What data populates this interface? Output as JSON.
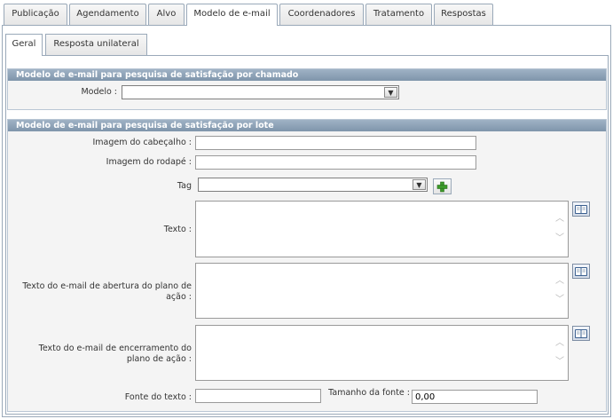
{
  "tabs": [
    {
      "label": "Publicação",
      "active": false
    },
    {
      "label": "Agendamento",
      "active": false
    },
    {
      "label": "Alvo",
      "active": false
    },
    {
      "label": "Modelo de e-mail",
      "active": true
    },
    {
      "label": "Coordenadores",
      "active": false
    },
    {
      "label": "Tratamento",
      "active": false
    },
    {
      "label": "Respostas",
      "active": false
    }
  ],
  "subtabs": [
    {
      "label": "Geral",
      "active": true
    },
    {
      "label": "Resposta unilateral",
      "active": false
    }
  ],
  "section_chamado": {
    "title": "Modelo de e-mail para pesquisa de satisfação por chamado",
    "modelo_label": "Modelo :",
    "modelo_value": ""
  },
  "section_lote": {
    "title": "Modelo de e-mail para pesquisa de satisfação por lote",
    "imagem_cabecalho_label": "Imagem do cabeçalho :",
    "imagem_cabecalho_value": "",
    "imagem_rodape_label": "Imagem do rodapé :",
    "imagem_rodape_value": "",
    "tag_label": "Tag",
    "tag_value": "",
    "texto_label": "Texto :",
    "texto_abertura_label_1": "Texto do e-mail de abertura do plano de",
    "texto_abertura_label_2": "ação :",
    "texto_encerramento_label_1": "Texto do e-mail de encerramento do",
    "texto_encerramento_label_2": "plano de ação :",
    "fonte_texto_label": "Fonte do texto :",
    "fonte_texto_value": "",
    "tamanho_fonte_label": "Tamanho da fonte :",
    "tamanho_fonte_value": "0,00"
  },
  "colors": {
    "section_header": "#8ca0b5",
    "border": "#9aa9b9",
    "add_icon": "#3c9a2a"
  },
  "icons": {
    "dropdown": "chevron-down-icon",
    "add": "plus-icon",
    "book": "book-icon"
  }
}
